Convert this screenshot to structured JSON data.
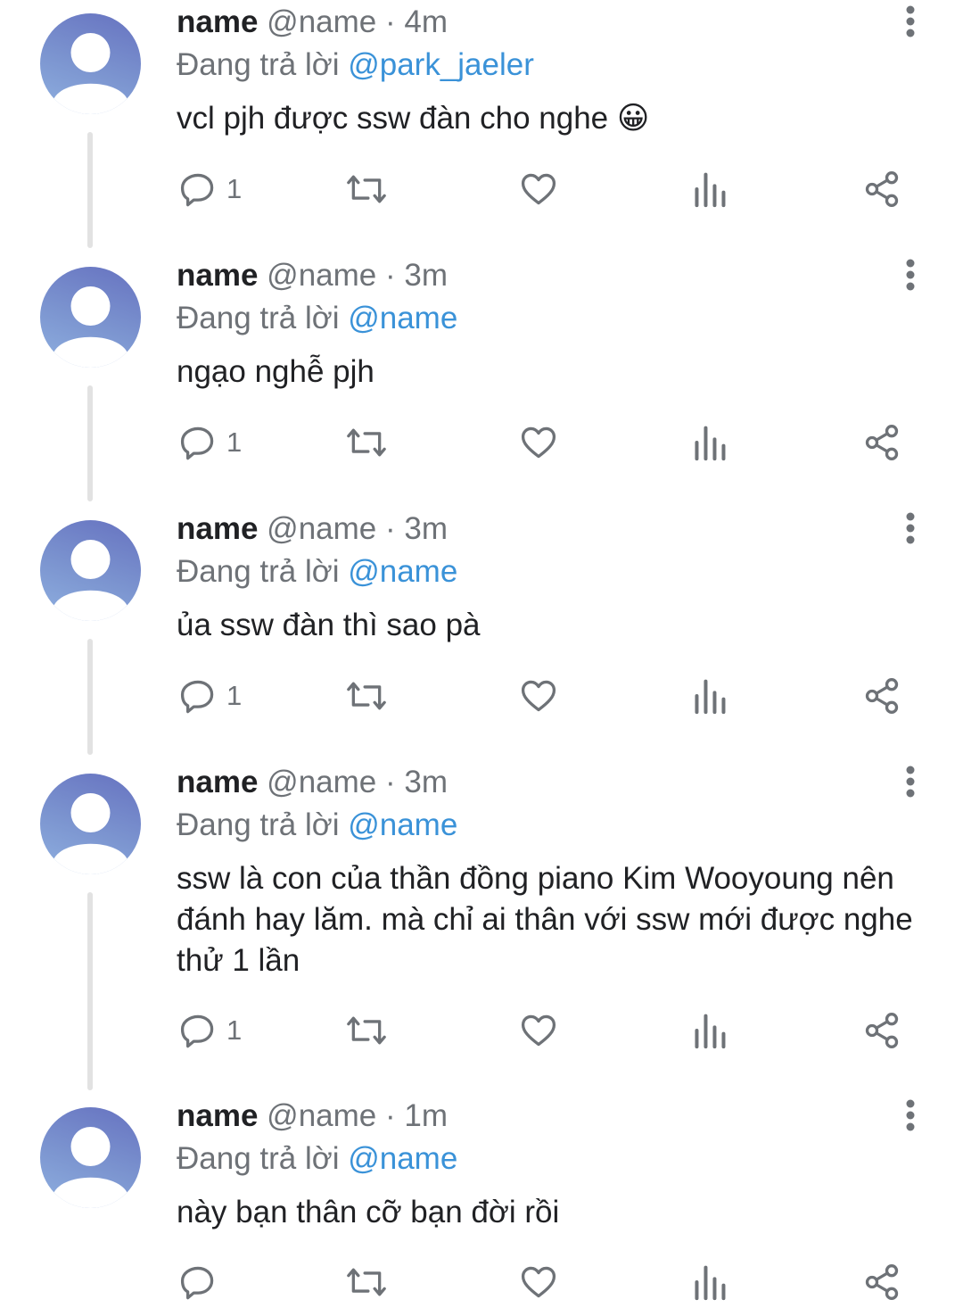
{
  "colors": {
    "text": "#202124",
    "muted": "#6e7277",
    "mention": "#3a92d8",
    "icon": "#6e7277",
    "thread_line": "#e2e2e2"
  },
  "tweets": [
    {
      "name": "name",
      "handle": "@name",
      "separator": "·",
      "time": "4m",
      "replying_prefix": "Đang trả lời",
      "replying_to": "@park_jaeler",
      "text": "vcl pjh được ssw đàn cho nghe 😀",
      "reply_count": "1"
    },
    {
      "name": "name",
      "handle": "@name",
      "separator": "·",
      "time": "3m",
      "replying_prefix": "Đang trả lời",
      "replying_to": "@name",
      "text": "ngạo nghễ pjh",
      "reply_count": "1"
    },
    {
      "name": "name",
      "handle": "@name",
      "separator": "·",
      "time": "3m",
      "replying_prefix": "Đang trả lời",
      "replying_to": "@name",
      "text": "ủa ssw đàn thì sao pà",
      "reply_count": "1"
    },
    {
      "name": "name",
      "handle": "@name",
      "separator": "·",
      "time": "3m",
      "replying_prefix": "Đang trả lời",
      "replying_to": "@name",
      "text": "ssw là con của thần đồng piano Kim Wooyoung nên đánh hay lăm. mà chỉ ai thân với ssw mới được nghe thử 1 lần",
      "reply_count": "1"
    },
    {
      "name": "name",
      "handle": "@name",
      "separator": "·",
      "time": "1m",
      "replying_prefix": "Đang trả lời",
      "replying_to": "@name",
      "text": "này bạn thân cỡ bạn đời rồi",
      "reply_count": ""
    }
  ],
  "icons": {
    "avatar": "default-avatar-icon",
    "more": "more-vertical-icon",
    "reply": "reply-bubble-icon",
    "retweet": "retweet-icon",
    "like": "heart-icon",
    "views": "bar-chart-icon",
    "share": "share-icon"
  }
}
